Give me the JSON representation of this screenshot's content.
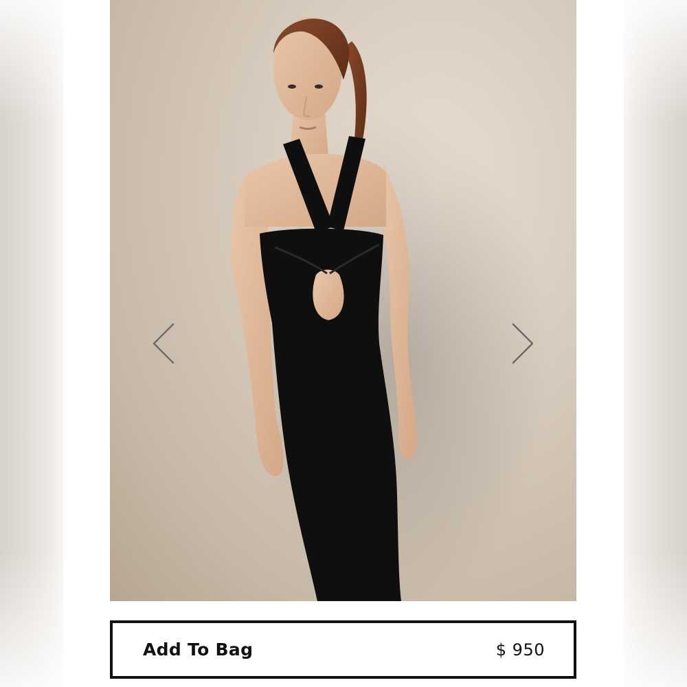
{
  "product": {
    "image_alt": "Model wearing black halter maxi dress with front cutout"
  },
  "carousel": {
    "prev_icon": "chevron-left-icon",
    "next_icon": "chevron-right-icon"
  },
  "cta": {
    "label": "Add To Bag",
    "price": "$ 950"
  },
  "colors": {
    "background": "#ffffff",
    "button_border": "#111111",
    "dress": "#0f0f0f"
  }
}
